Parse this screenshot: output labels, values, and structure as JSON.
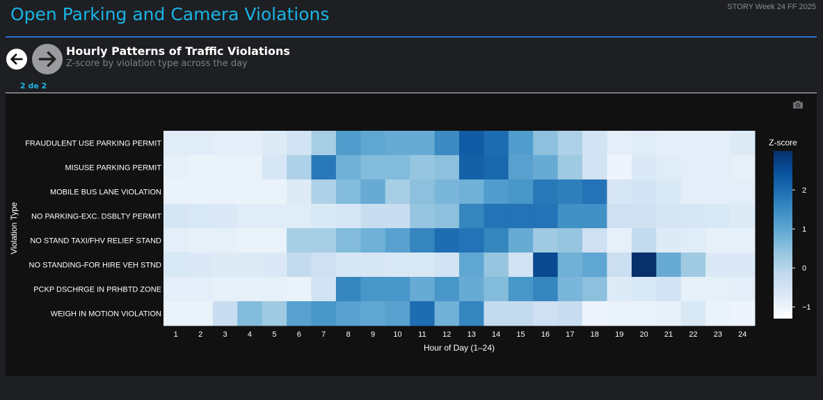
{
  "header": {
    "title": "Open Parking and Camera Violations",
    "story_label": "STORY Week 24 FF 2025"
  },
  "slide": {
    "title": "Hourly Patterns of Traffic Violations",
    "subtitle": "Z-score by violation type across the day",
    "page_indicator": "2 de 2"
  },
  "nav": {
    "prev_icon": "arrow-left-icon",
    "next_icon": "arrow-right-icon"
  },
  "toolbar": {
    "camera_icon": "camera-icon"
  },
  "colors": {
    "accent": "#19b4e6",
    "rule": "#2f6fd9",
    "panel_bg": "#111111",
    "page_bg": "#1e1f22"
  },
  "chart_data": {
    "type": "heatmap",
    "xlabel": "Hour of Day (1–24)",
    "ylabel": "Violation Type",
    "x": [
      1,
      2,
      3,
      4,
      5,
      6,
      7,
      8,
      9,
      10,
      11,
      12,
      13,
      14,
      15,
      16,
      17,
      18,
      19,
      20,
      21,
      22,
      23,
      24
    ],
    "y": [
      "FRAUDULENT USE PARKING PERMIT",
      "MISUSE PARKING PERMIT",
      "MOBILE BUS LANE VIOLATION",
      "NO PARKING-EXC. DSBLTY PERMIT",
      "NO STAND TAXI/FHV RELIEF STAND",
      "NO STANDING-FOR HIRE VEH STND",
      "PCKP DSCHRGE IN PRHBTD ZONE",
      "WEIGH IN MOTION VIOLATION"
    ],
    "z": [
      [
        -0.8,
        -0.8,
        -0.85,
        -0.85,
        -0.75,
        -0.5,
        0.2,
        1.2,
        1.0,
        0.9,
        0.9,
        1.5,
        2.3,
        2.0,
        1.2,
        0.5,
        0.1,
        -0.5,
        -0.85,
        -0.8,
        -0.85,
        -0.85,
        -0.85,
        -0.75
      ],
      [
        -0.9,
        -0.95,
        -0.95,
        -0.95,
        -0.6,
        0.1,
        1.8,
        0.8,
        0.6,
        0.6,
        0.4,
        0.5,
        2.2,
        2.1,
        1.1,
        0.9,
        0.3,
        -0.5,
        -1.0,
        -0.7,
        -0.8,
        -0.85,
        -0.85,
        -0.9
      ],
      [
        -0.95,
        -0.95,
        -0.95,
        -0.95,
        -0.95,
        -0.75,
        0.1,
        0.6,
        0.9,
        0.2,
        0.5,
        0.7,
        0.8,
        1.2,
        1.3,
        1.8,
        1.7,
        1.9,
        -0.6,
        -0.5,
        -0.65,
        -0.85,
        -0.85,
        -0.85
      ],
      [
        -0.55,
        -0.65,
        -0.7,
        -0.8,
        -0.8,
        -0.8,
        -0.65,
        -0.6,
        -0.3,
        -0.3,
        0.4,
        0.5,
        1.6,
        1.9,
        1.9,
        1.9,
        1.4,
        1.4,
        -0.4,
        -0.45,
        -0.55,
        -0.6,
        -0.65,
        -0.75
      ],
      [
        -0.85,
        -0.9,
        -0.9,
        -0.95,
        -0.95,
        0.2,
        0.2,
        0.6,
        0.8,
        1.1,
        1.6,
        2.0,
        1.9,
        1.6,
        0.9,
        0.3,
        0.4,
        -0.4,
        -0.9,
        -0.2,
        -0.75,
        -0.8,
        -0.9,
        -0.9
      ],
      [
        -0.65,
        -0.7,
        -0.75,
        -0.75,
        -0.7,
        -0.2,
        -0.4,
        -0.6,
        -0.6,
        -0.65,
        -0.65,
        -0.5,
        1.0,
        0.4,
        -0.5,
        2.6,
        0.8,
        1.0,
        -0.35,
        3.0,
        0.9,
        0.3,
        -0.7,
        -0.7
      ],
      [
        -0.85,
        -0.85,
        -0.9,
        -0.9,
        -0.9,
        -0.95,
        -0.5,
        1.6,
        1.3,
        1.3,
        0.9,
        1.3,
        0.9,
        0.6,
        1.3,
        1.6,
        0.7,
        0.5,
        -0.75,
        -0.65,
        -0.5,
        -0.9,
        -0.9,
        -0.85
      ],
      [
        -0.95,
        -0.95,
        -0.3,
        0.6,
        0.3,
        1.1,
        1.3,
        1.1,
        1.0,
        1.1,
        2.0,
        0.8,
        1.6,
        -0.2,
        -0.2,
        -0.4,
        -0.3,
        -1.0,
        -0.95,
        -0.95,
        -0.9,
        -0.65,
        -0.95,
        -1.0
      ]
    ],
    "zlim": [
      -1.3,
      3.0
    ],
    "colorscale": [
      "#ffffff",
      "#deebf7",
      "#c6dbef",
      "#9ecae1",
      "#6baed6",
      "#4292c6",
      "#2171b5",
      "#08519c",
      "#08306b"
    ],
    "colorbar": {
      "title": "Z-score",
      "ticks": [
        -1,
        0,
        1,
        2
      ],
      "tick_labels": [
        "−1",
        "0",
        "1",
        "2"
      ]
    },
    "grid": false
  }
}
